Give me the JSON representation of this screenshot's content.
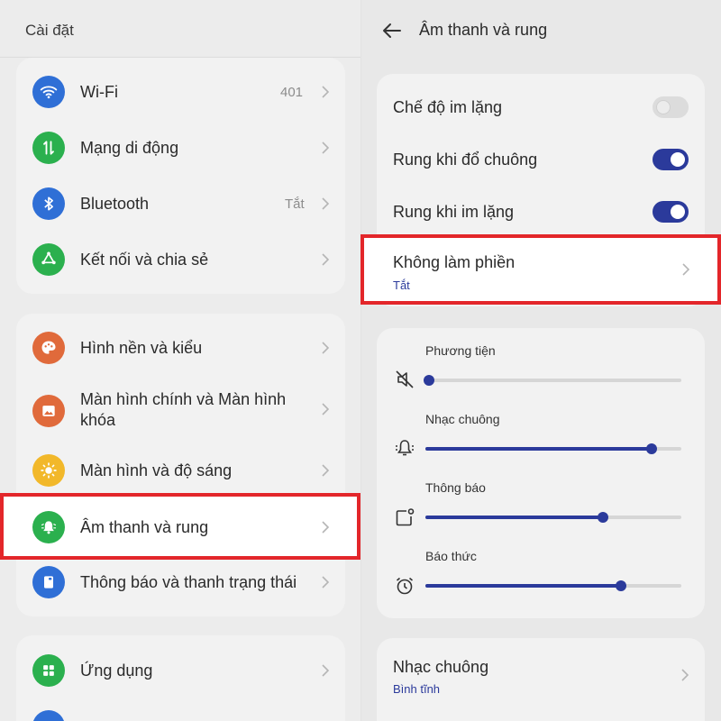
{
  "left": {
    "header": "Cài đặt",
    "items": [
      {
        "label": "Wi-Fi",
        "value": "401",
        "icon": "wifi-icon",
        "color": "#2f6fd6"
      },
      {
        "label": "Mạng di động",
        "value": "",
        "icon": "mobile-data-icon",
        "color": "#2bb04e"
      },
      {
        "label": "Bluetooth",
        "value": "Tắt",
        "icon": "bluetooth-icon",
        "color": "#2f6fd6"
      },
      {
        "label": "Kết nối và chia sẻ",
        "value": "",
        "icon": "share-icon",
        "color": "#2bb04e"
      },
      {
        "label": "Hình nền và kiểu",
        "value": "",
        "icon": "palette-icon",
        "color": "#e06a3b"
      },
      {
        "label_line1": "Màn hình chính và Màn hình",
        "label_line2": "khóa",
        "value": "",
        "icon": "home-screen-icon",
        "color": "#e06a3b"
      },
      {
        "label": "Màn hình và độ sáng",
        "value": "",
        "icon": "brightness-icon",
        "color": "#f2b82a"
      },
      {
        "label": "Âm thanh và rung",
        "value": "",
        "icon": "bell-icon",
        "color": "#2bb04e"
      },
      {
        "label": "Thông báo và thanh trạng thái",
        "value": "",
        "icon": "notification-icon",
        "color": "#2f6fd6"
      },
      {
        "label": "Ứng dụng",
        "value": "",
        "icon": "apps-icon",
        "color": "#2bb04e"
      }
    ]
  },
  "right": {
    "title": "Âm thanh và rung",
    "toggles": [
      {
        "label": "Chế độ im lặng",
        "state": "off"
      },
      {
        "label": "Rung khi đổ chuông",
        "state": "on"
      },
      {
        "label": "Rung khi im lặng",
        "state": "on"
      }
    ],
    "dnd": {
      "label": "Không làm phiền",
      "value": "Tắt"
    },
    "volumes": [
      {
        "label": "Phương tiện",
        "icon": "media-muted-icon",
        "level": 0.0
      },
      {
        "label": "Nhạc chuông",
        "icon": "ringtone-icon",
        "level": 0.87
      },
      {
        "label": "Thông báo",
        "icon": "notification-volume-icon",
        "level": 0.68
      },
      {
        "label": "Báo thức",
        "icon": "alarm-icon",
        "level": 0.75
      }
    ],
    "ringtone": {
      "label": "Nhạc chuông",
      "value": "Bình tĩnh"
    }
  },
  "colors": {
    "accent": "#2b3a9b",
    "highlight": "#e3262a"
  }
}
